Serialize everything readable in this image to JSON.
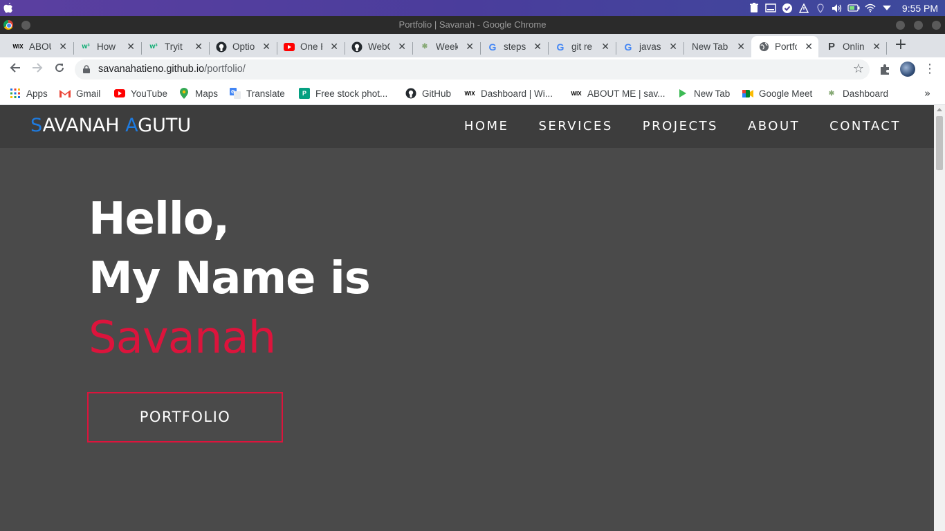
{
  "os": {
    "clock": "9:55 PM",
    "tray_icons": [
      "trash-icon",
      "display-icon",
      "check-icon",
      "alert-icon",
      "location-icon",
      "volume-icon",
      "battery-icon",
      "wifi-icon",
      "dropdown-icon"
    ]
  },
  "window": {
    "title": "Portfolio | Savanah - Google Chrome"
  },
  "tabs": [
    {
      "label": "ABOU",
      "favicon": "wix-icon"
    },
    {
      "label": "How",
      "favicon": "w3schools-icon"
    },
    {
      "label": "Tryit",
      "favicon": "w3schools-icon"
    },
    {
      "label": "Optio",
      "favicon": "github-icon"
    },
    {
      "label": "One P",
      "favicon": "youtube-icon"
    },
    {
      "label": "WebC",
      "favicon": "github-icon"
    },
    {
      "label": "Week",
      "favicon": "palm-icon"
    },
    {
      "label": "steps",
      "favicon": "google-icon"
    },
    {
      "label": "git re",
      "favicon": "google-icon"
    },
    {
      "label": "javas",
      "favicon": "google-icon"
    },
    {
      "label": "New Tab",
      "favicon": ""
    },
    {
      "label": "Portfo",
      "favicon": "globe-icon",
      "active": true
    },
    {
      "label": "Onlin",
      "favicon": "p-icon"
    }
  ],
  "address": {
    "host": "savanahatieno.github.io",
    "path": "/portfolio/"
  },
  "bookmarks": [
    {
      "label": "Apps",
      "icon": "apps-grid-icon"
    },
    {
      "label": "Gmail",
      "icon": "gmail-icon"
    },
    {
      "label": "YouTube",
      "icon": "youtube-icon"
    },
    {
      "label": "Maps",
      "icon": "maps-icon"
    },
    {
      "label": "Translate",
      "icon": "translate-icon"
    },
    {
      "label": "Free stock phot...",
      "icon": "pexels-icon"
    },
    {
      "label": "GitHub",
      "icon": "github-icon"
    },
    {
      "label": "Dashboard | Wi...",
      "icon": "wix-icon"
    },
    {
      "label": "ABOUT ME | sav...",
      "icon": "wix-icon"
    },
    {
      "label": "New Tab",
      "icon": "play-icon"
    },
    {
      "label": "Google Meet",
      "icon": "meet-icon"
    },
    {
      "label": "Dashboard",
      "icon": "palm-icon"
    }
  ],
  "site": {
    "brand_first_initial": "S",
    "brand_first_rest": "AVANAH",
    "brand_last_initial": "A",
    "brand_last_rest": "GUTU",
    "nav": [
      "HOME",
      "SERVICES",
      "PROJECTS",
      "ABOUT",
      "CONTACT"
    ],
    "hero_line1": "Hello,",
    "hero_line2": "My Name is",
    "hero_name": "Savanah",
    "cta_label": "PORTFOLIO",
    "colors": {
      "accent_blue": "#1e7be0",
      "accent_red": "#dc143c",
      "bg": "#4a4a4a",
      "nav_bg": "#3d3d3d"
    }
  }
}
